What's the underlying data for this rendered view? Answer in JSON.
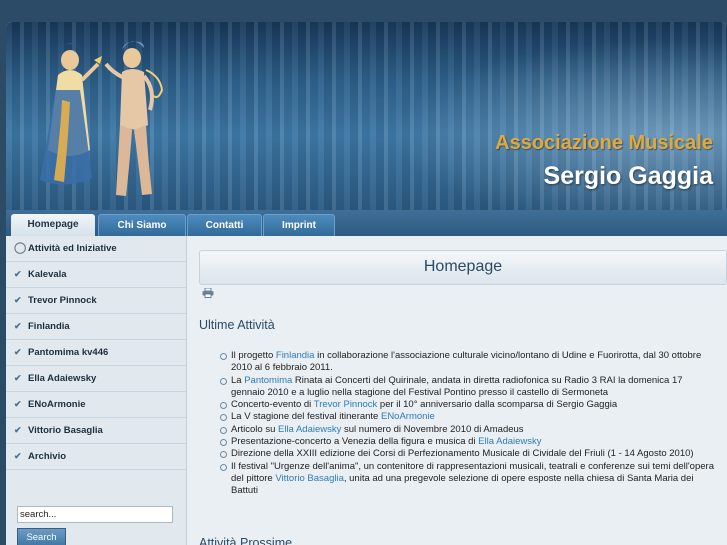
{
  "header": {
    "title_line1": "Associazione Musicale",
    "title_line2": "Sergio Gaggia"
  },
  "nav": {
    "tabs": [
      {
        "label": "Homepage",
        "active": true
      },
      {
        "label": "Chi Siamo",
        "active": false
      },
      {
        "label": "Contatti",
        "active": false
      },
      {
        "label": "Imprint",
        "active": false
      }
    ]
  },
  "sidebar": {
    "items": [
      {
        "label": "Attività ed Iniziative",
        "icon": "circle-icon"
      },
      {
        "label": "Kalevala",
        "icon": "check-icon"
      },
      {
        "label": "Trevor Pinnock",
        "icon": "check-icon"
      },
      {
        "label": "Finlandia",
        "icon": "check-icon"
      },
      {
        "label": "Pantomima kv446",
        "icon": "check-icon"
      },
      {
        "label": "Ella Adaiewsky",
        "icon": "check-icon"
      },
      {
        "label": "ENoArmonie",
        "icon": "check-icon"
      },
      {
        "label": "Vittorio Basaglia",
        "icon": "check-icon"
      },
      {
        "label": "Archivio",
        "icon": "check-icon"
      }
    ],
    "search": {
      "value": "search...",
      "button_label": "Search"
    }
  },
  "main": {
    "page_title": "Homepage",
    "section1_title": "Ultime Attività",
    "section2_title": "Attività Prossime",
    "news": [
      {
        "pre": "Il progetto ",
        "link": "Finlandia",
        "post": " in collaborazione l'associazione culturale vicino/lontano di Udine e Fuorirotta, dal 30 ottobre 2010 al 6 febbraio 2011."
      },
      {
        "pre": "La ",
        "link": "Pantomima",
        "post": " Rinata ai Concerti del Quirinale, andata in diretta radiofonica su Radio 3 RAI la domenica 17 gennaio 2010 e a luglio nella stagione del Festival Pontino presso il castello di Sermoneta"
      },
      {
        "pre": "Concerto-evento di ",
        "link": "Trevor Pinnock",
        "post": " per il 10° anniversario dalla scomparsa di Sergio Gaggia"
      },
      {
        "pre": "La V stagione del festival itinerante ",
        "link": "ENoArmonie",
        "post": ""
      },
      {
        "pre": "Articolo su ",
        "link": "Ella Adaiewsky",
        "post": " sul numero di Novembre 2010 di Amadeus"
      },
      {
        "pre": "Presentazione-concerto a Venezia della figura e musica di ",
        "link": "Ella Adaiewsky",
        "post": ""
      },
      {
        "pre": "Direzione della XXIII edizione dei Corsi di Perfezionamento Musicale di Cividale del Friuli (1 - 14 Agosto 2010)",
        "link": "",
        "post": ""
      },
      {
        "pre": "Il festival \"Urgenze dell'anima\", un contenitore di rappresentazioni musicali, teatrali e conferenze sui temi dell'opera del pittore ",
        "link": "Vittorio Basaglia",
        "post": ", unita ad una pregevole selezione di opere esposte nella chiesa di Santa Maria dei Battuti"
      }
    ]
  },
  "colors": {
    "accent": "#2e7bb8",
    "title_gold": "#e2a93a",
    "header_blue": "#2d5f89"
  }
}
